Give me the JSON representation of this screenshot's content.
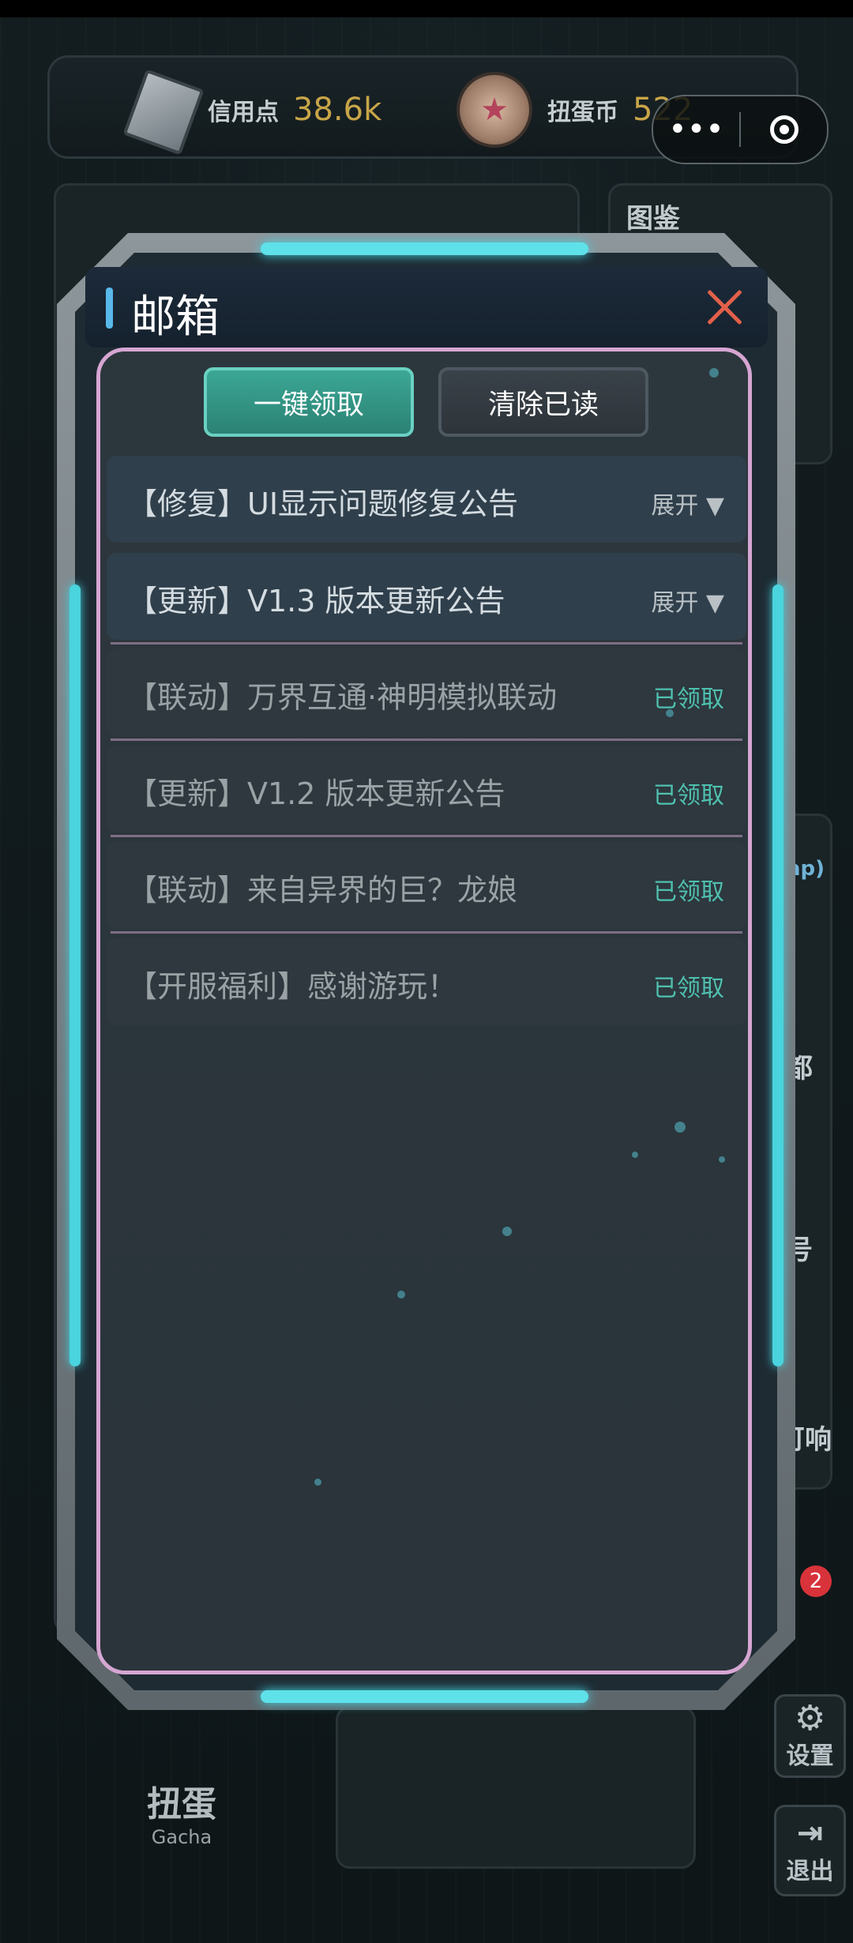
{
  "currency": {
    "credit_label": "信用点",
    "credit_value": "38.6k",
    "coin_label": "扭蛋币",
    "coin_value": "522"
  },
  "background": {
    "tab_atlas": "图鉴",
    "side_texts": [
      "ap)",
      "都",
      "号",
      "可响"
    ],
    "settings_label": "设置",
    "exit_label": "退出",
    "gacha_title": "扭蛋",
    "gacha_subtitle": "Gacha",
    "mail_badge_count": "2"
  },
  "modal": {
    "title": "邮箱",
    "claim_all_label": "一键领取",
    "clear_read_label": "清除已读",
    "mails": [
      {
        "title": "【修复】UI显示问题修复公告",
        "state": "展开 ▼",
        "status": "expand"
      },
      {
        "title": "【更新】V1.3 版本更新公告",
        "state": "展开 ▼",
        "status": "expand"
      },
      {
        "title": "【联动】万界互通·神明模拟联动",
        "state": "已领取",
        "status": "claimed"
      },
      {
        "title": "【更新】V1.2 版本更新公告",
        "state": "已领取",
        "status": "claimed"
      },
      {
        "title": "【联动】来自异界的巨？龙娘",
        "state": "已领取",
        "status": "claimed"
      },
      {
        "title": "【开服福利】感谢游玩！",
        "state": "已领取",
        "status": "claimed"
      }
    ]
  },
  "colors": {
    "accent_cyan": "#4ad4de",
    "claimed_text": "#4fc0b0",
    "close_red": "#e2604a",
    "currency_gold": "#c8a548"
  }
}
